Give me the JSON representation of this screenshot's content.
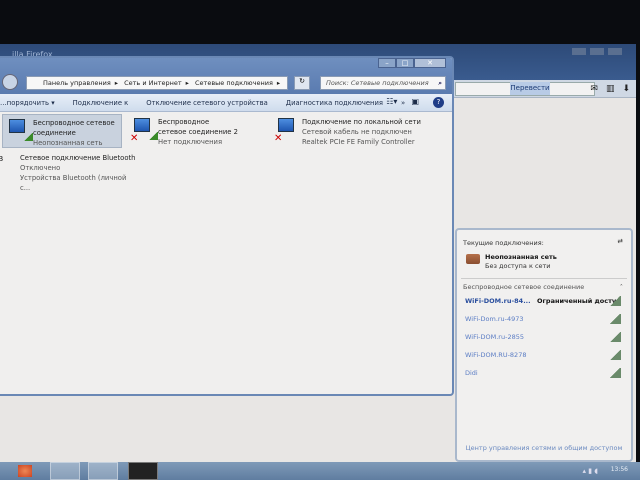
{
  "firefox": {
    "title": "…illa Firefox",
    "translate_label": "Перевести"
  },
  "explorer": {
    "breadcrumb": [
      "Панель управления",
      "Сеть и Интернет",
      "Сетевые подключения"
    ],
    "search_placeholder": "Поиск: Сетевые подключения",
    "toolbar": [
      "…порядочить ▾",
      "Подключение к",
      "Отключение сетевого устройства",
      "Диагностика подключения",
      "»"
    ],
    "connections": [
      {
        "name": "Беспроводное сетевое соединение",
        "status": "Неопознанная сеть",
        "selected": true
      },
      {
        "name": "Беспроводное сетевое соединение 2",
        "status": "Нет подключения"
      },
      {
        "name": "Подключение по локальной сети",
        "status": "Сетевой кабель не подключен",
        "device": "Realtek PCIe FE Family Controller"
      },
      {
        "name": "Сетевое подключение Bluetooth",
        "status": "Отключено",
        "device": "Устройства Bluetooth (личной с..."
      }
    ]
  },
  "popup": {
    "header": "Текущие подключения:",
    "current_name": "Неопознанная сеть",
    "current_status": "Без доступа к сети",
    "section": "Беспроводное сетевое соединение",
    "networks": [
      {
        "ssid": "WiFi-DOM.ru-84...",
        "status": "Ограниченный доступ"
      },
      {
        "ssid": "WiFi-Dom.ru-4973"
      },
      {
        "ssid": "WiFi-DOM.ru-2855"
      },
      {
        "ssid": "WiFi-DOM.RU-8278"
      },
      {
        "ssid": "Didi"
      }
    ],
    "footer_link": "Центр управления сетями и общим доступом"
  },
  "taskbar": {
    "clock": "13:56"
  }
}
